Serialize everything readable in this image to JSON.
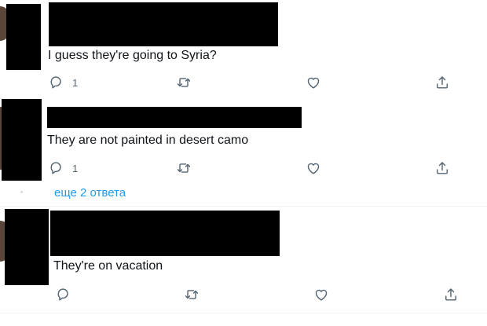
{
  "tweets": [
    {
      "text": "I guess they're going to Syria?",
      "reply_count": "1",
      "icons": [
        "reply-icon",
        "retweet-icon",
        "like-icon",
        "share-icon"
      ]
    },
    {
      "text": "They are not painted in desert camo",
      "reply_count": "1",
      "icons": [
        "reply-icon",
        "retweet-icon",
        "like-icon",
        "share-icon"
      ]
    },
    {
      "text": "They're on vacation",
      "reply_count": "",
      "icons": [
        "reply-icon",
        "retweet-icon",
        "like-icon",
        "share-icon"
      ]
    }
  ],
  "more_replies": "еще 2 ответа",
  "colors": {
    "icon": "#536471",
    "link": "#1d9bf0",
    "redaction": "#000000",
    "separator": "#eff3f4"
  }
}
